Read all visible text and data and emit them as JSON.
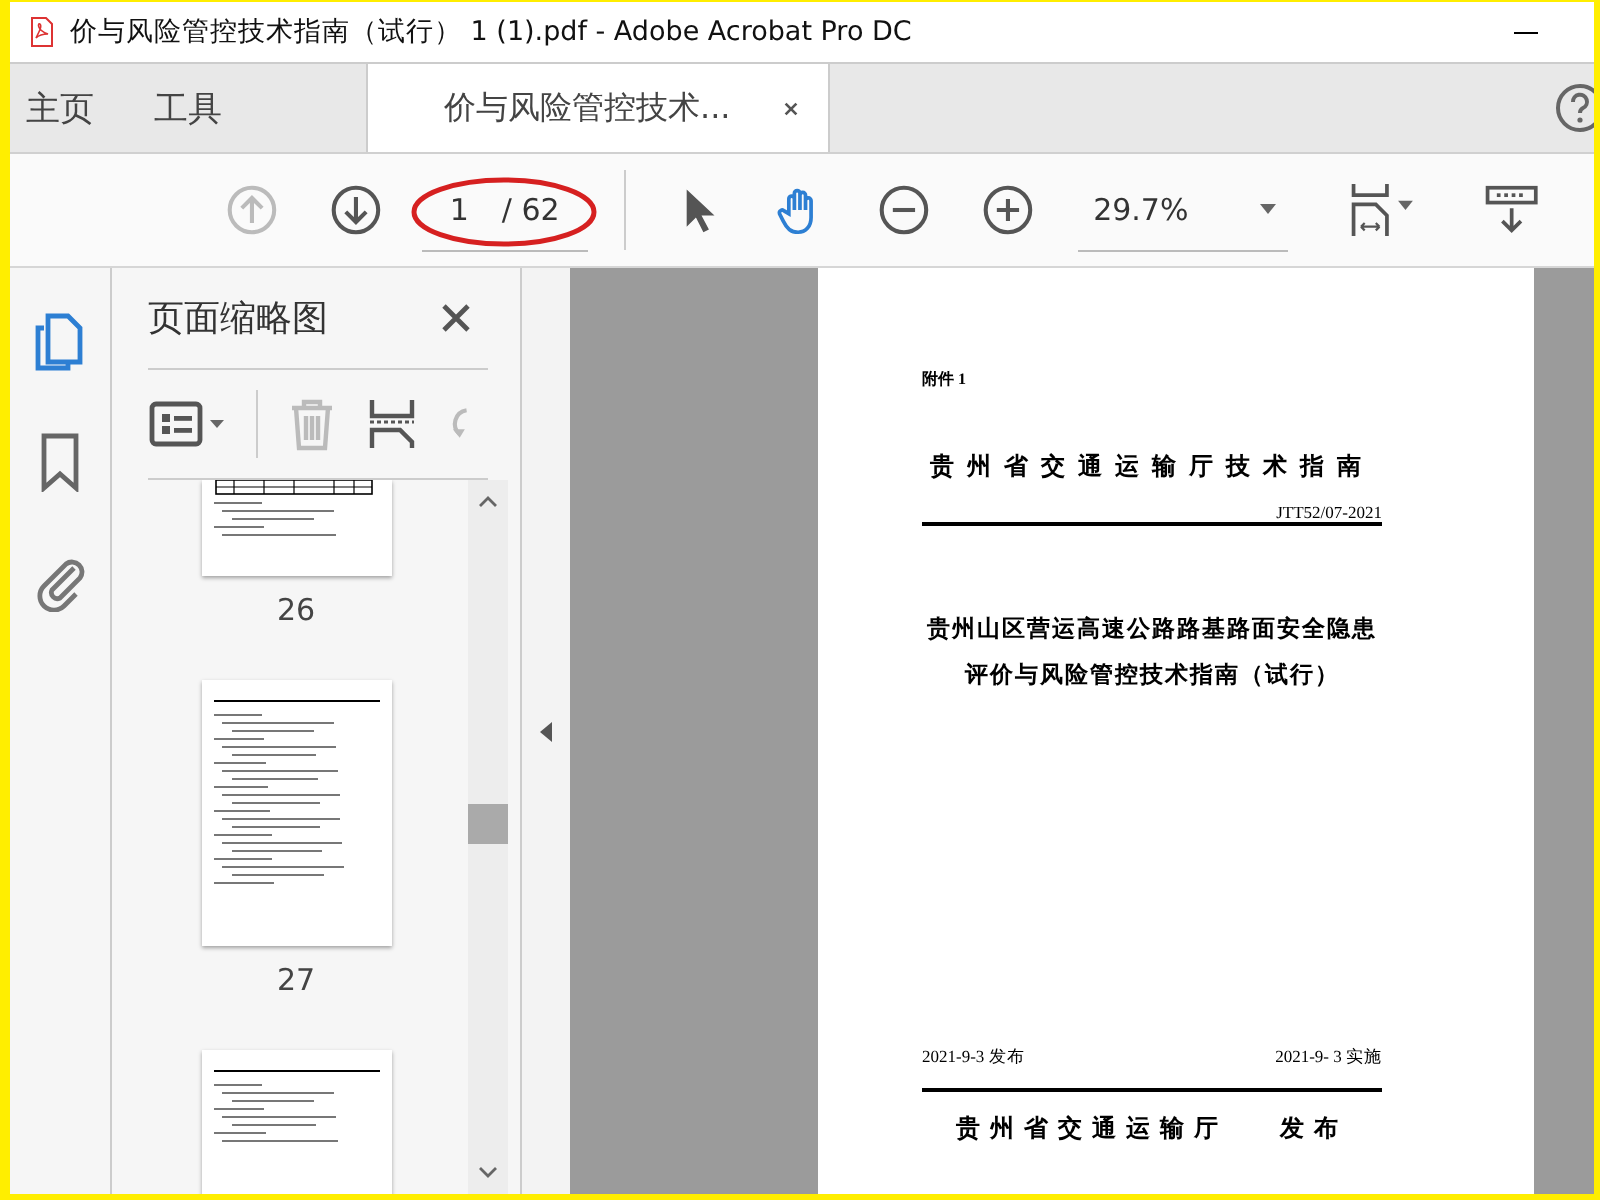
{
  "window": {
    "title": "价与风险管控技术指南（试行） 1 (1).pdf - Adobe Acrobat Pro DC"
  },
  "tabs": [
    {
      "label": "主页",
      "selected": false,
      "closable": false
    },
    {
      "label": "工具",
      "selected": false,
      "closable": false
    },
    {
      "label": "价与风险管控技术...",
      "selected": true,
      "closable": true
    }
  ],
  "toolbar": {
    "prev_disabled": true,
    "next_disabled": false,
    "page_field": {
      "value": "1",
      "total": "/ 62",
      "circled": true
    },
    "tools": [
      {
        "kind": "select",
        "selected": false
      },
      {
        "kind": "hand",
        "selected": true
      }
    ],
    "zoom": "29.7%"
  },
  "rail_items": [
    {
      "kind": "pages",
      "selected": true
    },
    {
      "kind": "bookmarks",
      "selected": false
    },
    {
      "kind": "attachments",
      "selected": false
    }
  ],
  "thumbnail_panel": {
    "title": "页面缩略图",
    "thumbnails": [
      {
        "label": "26"
      },
      {
        "label": "27"
      }
    ],
    "more_below": true
  },
  "document": {
    "attachment": "附件 1",
    "header": "贵州省交通运输厅技术指南",
    "code": "JTT52/07-2021",
    "title_lines": [
      "贵州山区营运高速公路路基路面安全隐患",
      "评价与风险管控技术指南（试行）"
    ],
    "issue_date": "2021-9-3  发布",
    "effective_date": "2021-9- 3 实施",
    "issuer": "贵州省交通运输厅",
    "issue_word": "发布"
  }
}
